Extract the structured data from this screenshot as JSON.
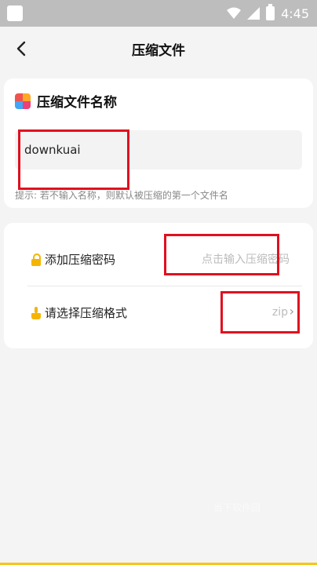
{
  "status_bar": {
    "time": "4:45"
  },
  "header": {
    "back_icon": "chevron-left-icon",
    "title": "压缩文件"
  },
  "name_section": {
    "icon": "app-grid-icon",
    "title": "压缩文件名称",
    "input_value": "downkuai",
    "hint": "提示: 若不输入名称，则默认被压缩的第一个文件名"
  },
  "options": {
    "password": {
      "icon": "lock-icon",
      "label": "添加压缩密码",
      "placeholder": "点击输入压缩密码"
    },
    "format": {
      "icon": "brush-icon",
      "label": "请选择压缩格式",
      "value": "zip",
      "chevron": "›"
    }
  },
  "watermark": "当下软件园",
  "colors": {
    "accent": "#f5b400",
    "highlight": "#e0101f",
    "background": "#f4f4f4"
  }
}
